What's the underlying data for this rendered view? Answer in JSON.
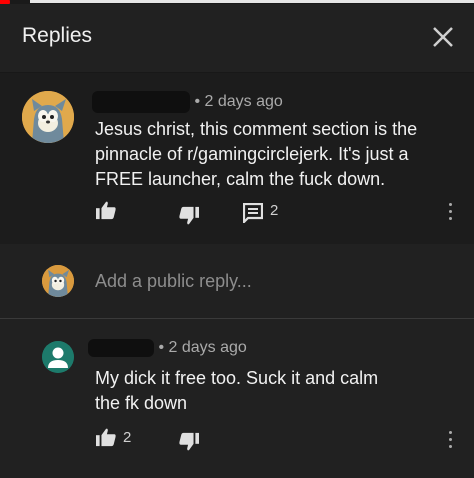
{
  "header": {
    "title": "Replies",
    "close_icon": "close-icon"
  },
  "parent_comment": {
    "time": "• 2 days ago",
    "text_lines": [
      "Jesus christ, this comment section is the",
      "pinnacle of r/gamingcirclejerk. It's just a",
      "FREE launcher, calm the fuck down."
    ],
    "reply_count": "2"
  },
  "reply_composer": {
    "placeholder": "Add a public reply..."
  },
  "child_comment": {
    "time": "• 2 days ago",
    "text_lines": [
      "My dick it free too. Suck it and calm",
      "the fk down"
    ],
    "like_count": "2"
  },
  "colors": {
    "background": "#212121",
    "parent_bg": "#1c1c1c",
    "text": "#f1f1f1",
    "muted": "#aaaaaa",
    "avatar_green": "#1d7a6b"
  }
}
